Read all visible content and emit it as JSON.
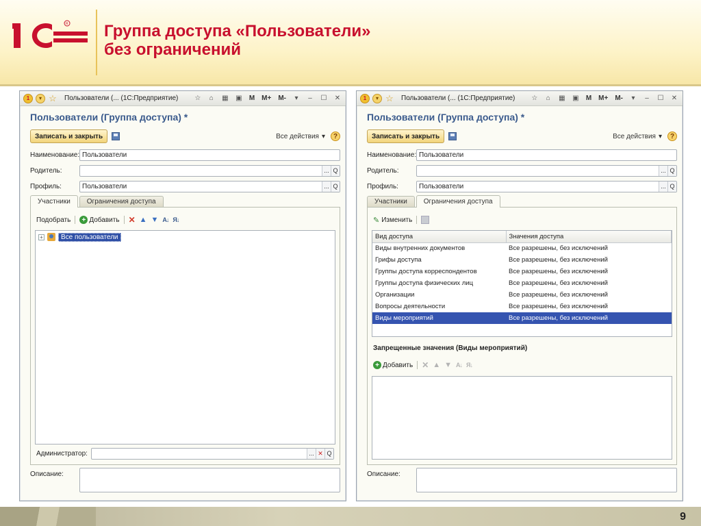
{
  "slide": {
    "title_line1": "Группа доступа «Пользователи»",
    "title_line2": "без ограничений",
    "page_number": "9",
    "logo_text": "1С"
  },
  "colors": {
    "title": "#c8102e",
    "form_title": "#3a5a8c",
    "selection": "#3554b0"
  },
  "window_common": {
    "caption": "Пользователи (... (1С:Предприятие)",
    "m_labels": [
      "M",
      "M+",
      "M-"
    ],
    "form_title": "Пользователи (Группа доступа) *",
    "save_close": "Записать и закрыть",
    "all_actions": "Все действия",
    "help": "?",
    "name_label": "Наименование:",
    "name_value": "Пользователи",
    "parent_label": "Родитель:",
    "parent_value": "",
    "profile_label": "Профиль:",
    "profile_value": "Пользователи",
    "tab_members": "Участники",
    "tab_restrictions": "Ограничения доступа",
    "description_label": "Описание:",
    "ellipsis": "...",
    "search_glyph": "Q"
  },
  "left": {
    "pick": "Подобрать",
    "add": "Добавить",
    "tree_item": "Все пользователи",
    "admin_label": "Администратор:",
    "admin_value": ""
  },
  "right": {
    "edit": "Изменить",
    "grid_headers": [
      "Вид доступа",
      "Значения доступа"
    ],
    "grid_rows": [
      [
        "Виды внутренних документов",
        "Все разрешены, без исключений"
      ],
      [
        "Грифы доступа",
        "Все разрешены, без исключений"
      ],
      [
        "Группы доступа корреспондентов",
        "Все разрешены, без исключений"
      ],
      [
        "Группы доступа физических лиц",
        "Все разрешены, без исключений"
      ],
      [
        "Организации",
        "Все разрешены, без исключений"
      ],
      [
        "Вопросы деятельности",
        "Все разрешены, без исключений"
      ],
      [
        "Виды мероприятий",
        "Все разрешены, без исключений"
      ]
    ],
    "selected_row": 6,
    "forbidden_title": "Запрещенные значения (Виды мероприятий)",
    "add": "Добавить"
  }
}
